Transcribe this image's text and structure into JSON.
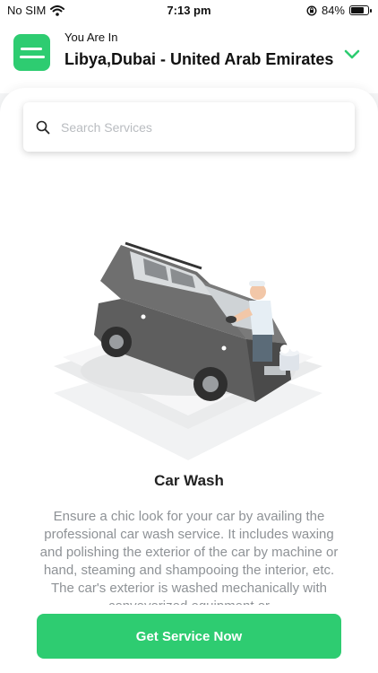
{
  "status_bar": {
    "carrier": "No SIM",
    "time": "7:13 pm",
    "battery_text": "84%",
    "battery_level": 0.84,
    "icons": [
      "wifi-icon",
      "rotation-lock-icon",
      "battery-icon"
    ]
  },
  "header": {
    "location_caption": "You Are In",
    "location_value": "Libya,Dubai - United Arab Emirates",
    "icons": [
      "menu-icon",
      "chevron-down-icon"
    ]
  },
  "search": {
    "placeholder": "Search Services",
    "value": ""
  },
  "service": {
    "title": "Car Wash",
    "description": "Ensure a chic look for your car by availing the professional car wash service. It includes waxing and polishing the exterior of the car by machine or hand, steaming and shampooing the interior, etc. The car's exterior is washed mechanically with conveyorized equipment or"
  },
  "cta": {
    "label": "Get Service Now"
  },
  "colors": {
    "accent": "#2ecc71",
    "text_dark": "#222222",
    "text_muted": "#8e9296",
    "placeholder": "#b9bcc0"
  }
}
